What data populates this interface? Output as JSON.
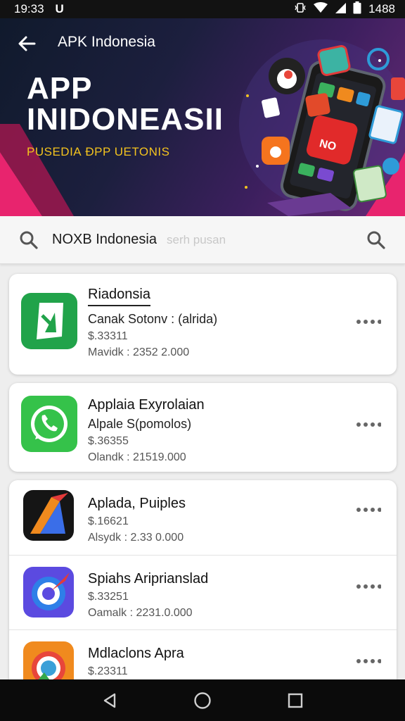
{
  "status_bar": {
    "time": "19:33",
    "left_badge": "U",
    "battery_text": "1488"
  },
  "app_bar": {
    "title": "APK Indonesia"
  },
  "hero": {
    "title": "APP INIDONEASII",
    "subtitle": "PUSEDIА ĐPP UETONIS",
    "sign_text": "NO"
  },
  "search": {
    "query": "NOXB  Indonesia",
    "placeholder": "serh pusan"
  },
  "apps": [
    {
      "name": "Riadonsia",
      "developer": "Canak Sotonv : (alrida)",
      "price": "$.33311",
      "downloads_label": "Mavidk :",
      "downloads_value": "2352 2.000",
      "icon": "green-tile-icon"
    },
    {
      "name": "Applaia Exyrolaian",
      "developer": "Alpale S(pomolos)",
      "price": "$.36355",
      "downloads_label": "Olandk :",
      "downloads_value": "21519.000",
      "icon": "phone-chat-icon"
    },
    {
      "name": "Aplada, Puiples",
      "price": "$.16621",
      "downloads_label": "Alsydk :",
      "downloads_value": "2.33 0.000",
      "icon": "arrow-tile-icon"
    },
    {
      "name": "Spiahs Ariprianslad",
      "price": "$.33251",
      "downloads_label": "Oamalk :",
      "downloads_value": "2231.0.000",
      "icon": "spiral-icon"
    },
    {
      "name": "Mdlaclons Apra",
      "price": "$.23311",
      "icon": "browser-ring-icon"
    }
  ],
  "more_icon": "more-dots-icon",
  "nav": {
    "back": "nav-back-icon",
    "home": "nav-home-icon",
    "recents": "nav-recents-icon"
  },
  "colors": {
    "hero_accent": "#f3c31e",
    "pink_accent": "#e8246e",
    "status_bg": "#121212"
  }
}
